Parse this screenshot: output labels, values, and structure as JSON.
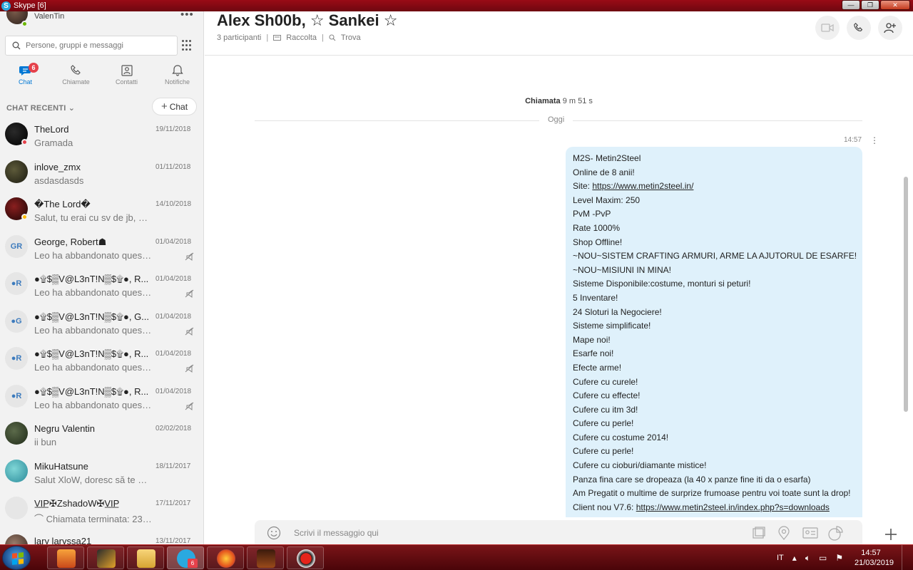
{
  "window": {
    "title": "Skype [6]"
  },
  "profile": {
    "name": "ValenTin",
    "more": "•••"
  },
  "search": {
    "placeholder": "Persone, gruppi e messaggi"
  },
  "nav": {
    "items": [
      {
        "label": "Chat",
        "icon": "chat-icon",
        "badge": "6",
        "active": true
      },
      {
        "label": "Chiamate",
        "icon": "phone-icon"
      },
      {
        "label": "Contatti",
        "icon": "contacts-icon"
      },
      {
        "label": "Notifiche",
        "icon": "bell-icon"
      }
    ]
  },
  "recent": {
    "title": "CHAT RECENTI",
    "chevron": "⌄",
    "new_chat_label": "Chat",
    "new_chat_plus": "+"
  },
  "conversations": [
    {
      "name": "TheLord",
      "preview": "Gramada",
      "date": "19/11/2018",
      "avatar": "",
      "status": "#e5414b"
    },
    {
      "name": "inlove_zmx",
      "preview": "asdasdasds",
      "date": "01/11/2018",
      "avatar": "",
      "status": ""
    },
    {
      "name": "�The Lord�",
      "preview": "Salut, tu erai cu sv de jb, pa...",
      "date": "14/10/2018",
      "avatar": "",
      "status": "#ffb900"
    },
    {
      "name": "George, Robert☗",
      "preview": "Leo ha abbandonato quest...",
      "date": "01/04/2018",
      "avatar": "GR",
      "status": "",
      "muted": true
    },
    {
      "name": "●۩$▒V@L3nT!N▒$۩●, R...",
      "preview": "Leo ha abbandonato quest...",
      "date": "01/04/2018",
      "avatar": "●R",
      "status": "",
      "muted": true
    },
    {
      "name": "●۩$▒V@L3nT!N▒$۩●, G...",
      "preview": "Leo ha abbandonato quest...",
      "date": "01/04/2018",
      "avatar": "●G",
      "status": "",
      "muted": true
    },
    {
      "name": "●۩$▒V@L3nT!N▒$۩●, R...",
      "preview": "Leo ha abbandonato quest...",
      "date": "01/04/2018",
      "avatar": "●R",
      "status": "",
      "muted": true
    },
    {
      "name": "●۩$▒V@L3nT!N▒$۩●, R...",
      "preview": "Leo ha abbandonato quest...",
      "date": "01/04/2018",
      "avatar": "●R",
      "status": "",
      "muted": true
    },
    {
      "name": "Negru Valentin",
      "preview": "ii bun",
      "date": "02/02/2018",
      "avatar": "",
      "status": ""
    },
    {
      "name": "MikuHatsune",
      "preview": "Salut XloW, doresc să te ad...",
      "date": "18/11/2017",
      "avatar": "",
      "status": ""
    },
    {
      "name": "V̲I̲P̲✠ZshadoW✠V̲I̲P̲",
      "preview": "⌒ Chiamata terminata: 23 m",
      "date": "17/11/2017",
      "avatar": "",
      "status": ""
    },
    {
      "name": "lary laryssa21",
      "preview": "",
      "date": "13/11/2017",
      "avatar": "",
      "status": ""
    }
  ],
  "chat": {
    "title": "Alex Sh00b, ☆ Sankei ☆",
    "participants": "3 participanti",
    "gallery": "Raccolta",
    "find": "Trova",
    "call_label": "Chiamata",
    "call_duration": "9 m 51 s",
    "day_label": "Oggi",
    "message_time": "14:57",
    "message_lines": [
      "M2S- Metin2Steel",
      "Online de 8 anii!",
      "Site: |https://www.metin2steel.in/",
      "Level Maxim: 250",
      "PvM -PvP",
      "Rate 1000%",
      "Shop Offline!",
      "~NOU~SISTEM CRAFTING ARMURI, ARME LA AJUTORUL DE ESARFE!",
      "~NOU~MISIUNI IN MINA!",
      "Sisteme Disponibile:costume, monturi si peturi!",
      "5 Inventare!",
      "24 Sloturi la Negociere!",
      "Sisteme simplificate!",
      "Mape noi!",
      "Esarfe noi!",
      "Efecte arme!",
      "Cufere cu curele!",
      "Cufere cu effecte!",
      "Cufere cu itm 3d!",
      "Cufere cu perle!",
      "Cufere cu costume 2014!",
      "Cufere cu perle!",
      "Cufere cu cioburi/diamante mistice!",
      "Panza fina care se dropeaza (la 40 x panze fine iti da o esarfa)",
      "Am Pregatit o multime de surprize frumoase pentru voi toate sunt la drop!",
      "Client nou V7.6: |https://www.metin2steel.in/index.php?s=downloads"
    ],
    "composer_placeholder": "Scrivi il messaggio qui"
  },
  "taskbar": {
    "language": "IT",
    "time": "14:57",
    "date": "21/03/2019",
    "skype_badge": "6"
  },
  "colors": {
    "accent": "#0078d4",
    "bubble": "#dff1fb",
    "taskbar": "#6e0710",
    "badge": "#e5414b"
  }
}
